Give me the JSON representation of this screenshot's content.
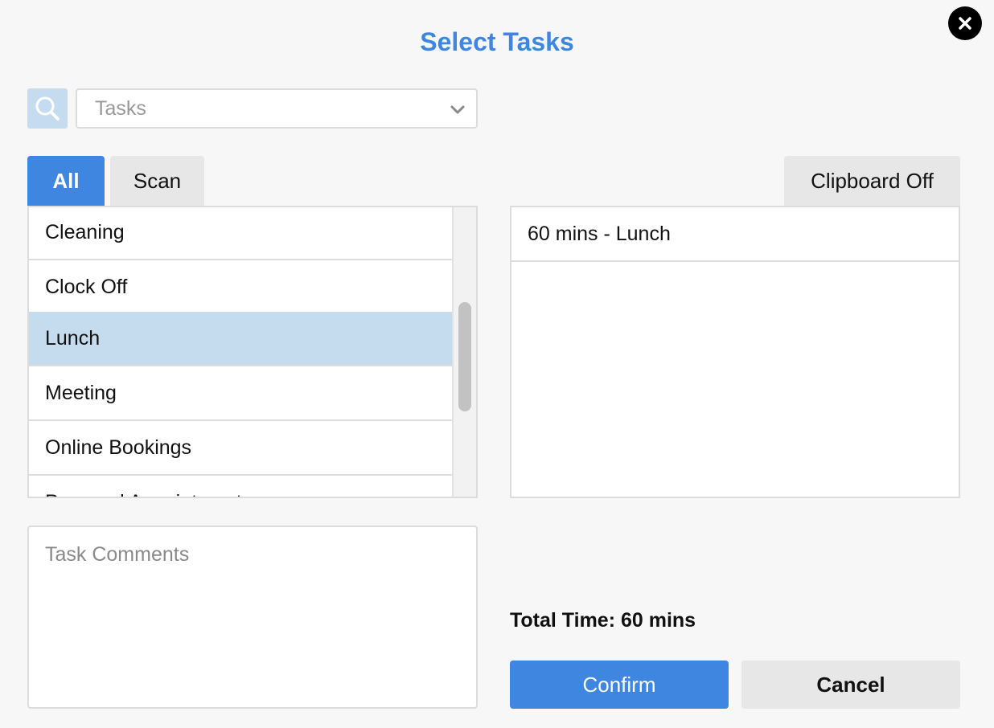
{
  "dialog": {
    "title": "Select Tasks"
  },
  "search": {
    "placeholder": "Tasks"
  },
  "tabs": [
    {
      "label": "All",
      "active": true
    },
    {
      "label": "Scan",
      "active": false
    }
  ],
  "clipboard": {
    "label": "Clipboard Off"
  },
  "task_list": {
    "items": [
      {
        "label": "Cleaning",
        "selected": false
      },
      {
        "label": "Clock Off",
        "selected": false
      },
      {
        "label": "Lunch",
        "selected": true
      },
      {
        "label": "Meeting",
        "selected": false
      },
      {
        "label": "Online Bookings",
        "selected": false
      },
      {
        "label": "Personal Appointment",
        "selected": false
      }
    ]
  },
  "selected_tasks": {
    "items": [
      {
        "label": "60 mins - Lunch"
      }
    ]
  },
  "comments": {
    "placeholder": "Task Comments"
  },
  "summary": {
    "total_label": "Total Time: 60 mins"
  },
  "actions": {
    "confirm_label": "Confirm",
    "cancel_label": "Cancel"
  },
  "colors": {
    "accent": "#3f86e1",
    "selected_row": "#c5dbee",
    "search_button": "#c5dcf0"
  }
}
